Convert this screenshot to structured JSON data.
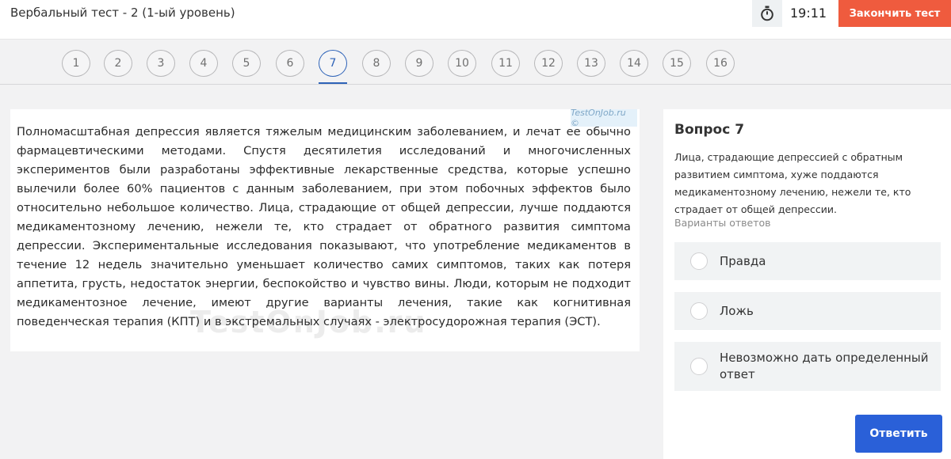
{
  "header": {
    "title": "Вербальный тест - 2 (1-ый уровень)",
    "timer_icon": "stopwatch-icon",
    "timer": "19:11",
    "finish_label": "Закончить тест",
    "finish_color": "#ef5b3e"
  },
  "nav": {
    "questions": [
      "1",
      "2",
      "3",
      "4",
      "5",
      "6",
      "7",
      "8",
      "9",
      "10",
      "11",
      "12",
      "13",
      "14",
      "15",
      "16"
    ],
    "active": "7",
    "accent": "#2e63b8"
  },
  "passage": {
    "text": "Полномасштабная депрессия является тяжелым медицинским заболеванием, и лечат ее обычно фармацевтическими методами. Спустя десятилетия исследований и многочисленных экспериментов были разработаны эффективные лекарственные средства, которые успешно вылечили более 60% пациентов с данным заболеванием, при этом побочных эффектов было относительно небольшое количество. Лица, страдающие от общей депрессии, лучше поддаются медикаментозному лечению, нежели те, кто страдает от обратного развития симптома депрессии. Экспериментальные исследования показывают, что употребление медикаментов в течение 12 недель значительно уменьшает количество самих симптомов, таких как потеря аппетита, грусть, недостаток энергии, беспокойство и чувство вины. Люди, которым не подходит медикаментозное лечение, имеют другие варианты лечения, такие как когнитивная поведенческая терапия (КПТ) и в экстремальных случаях - электросудорожная терапия (ЭСТ).",
    "watermark_tag": "TestOnJob.ru ©",
    "watermark_big": "TestOnJob.ru"
  },
  "question": {
    "title": "Вопрос 7",
    "text": "Лица, страдающие депрессией с обратным развитием симптома, хуже поддаются медикаментозному лечению, нежели те, кто страдает от общей депрессии.",
    "options_label": "Варианты ответов",
    "options": [
      {
        "label": "Правда"
      },
      {
        "label": "Ложь"
      },
      {
        "label": "Невозможно дать определенный ответ"
      }
    ],
    "submit_label": "Ответить",
    "submit_color": "#2a60d8"
  }
}
